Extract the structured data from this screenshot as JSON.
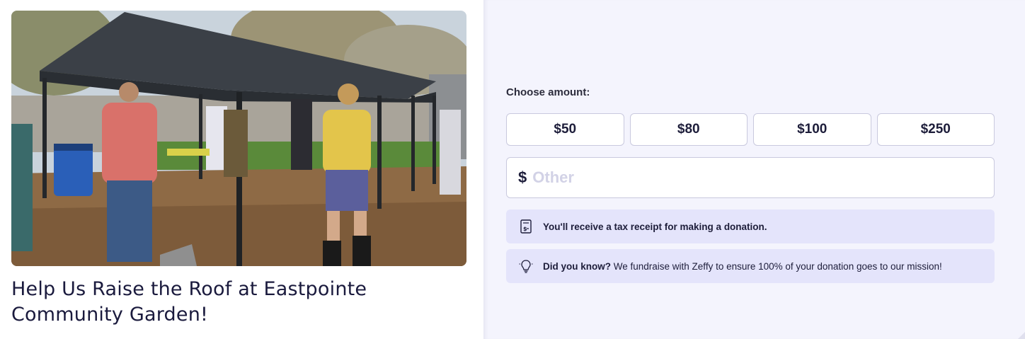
{
  "campaign": {
    "title": "Help Us Raise the Roof at Eastpointe Community Garden!",
    "photo_icon": "garden-carport-photo"
  },
  "donation": {
    "choose_label": "Choose amount:",
    "amounts": [
      "$50",
      "$80",
      "$100",
      "$250"
    ],
    "currency_symbol": "$",
    "other_placeholder": "Other",
    "other_value": ""
  },
  "notices": {
    "tax_receipt": "You'll receive a tax receipt for making a donation.",
    "tax_receipt_icon": "receipt-icon",
    "did_you_know_lead": "Did you know?",
    "did_you_know_text": " We fundraise with Zeffy to ensure 100% of your donation goes to our mission!",
    "did_you_know_icon": "lightbulb-icon"
  },
  "colors": {
    "panel_bg": "#f4f4fd",
    "notice_bg": "#e4e4fb",
    "text_dark": "#1d1d3a",
    "border": "#c9c9de"
  }
}
